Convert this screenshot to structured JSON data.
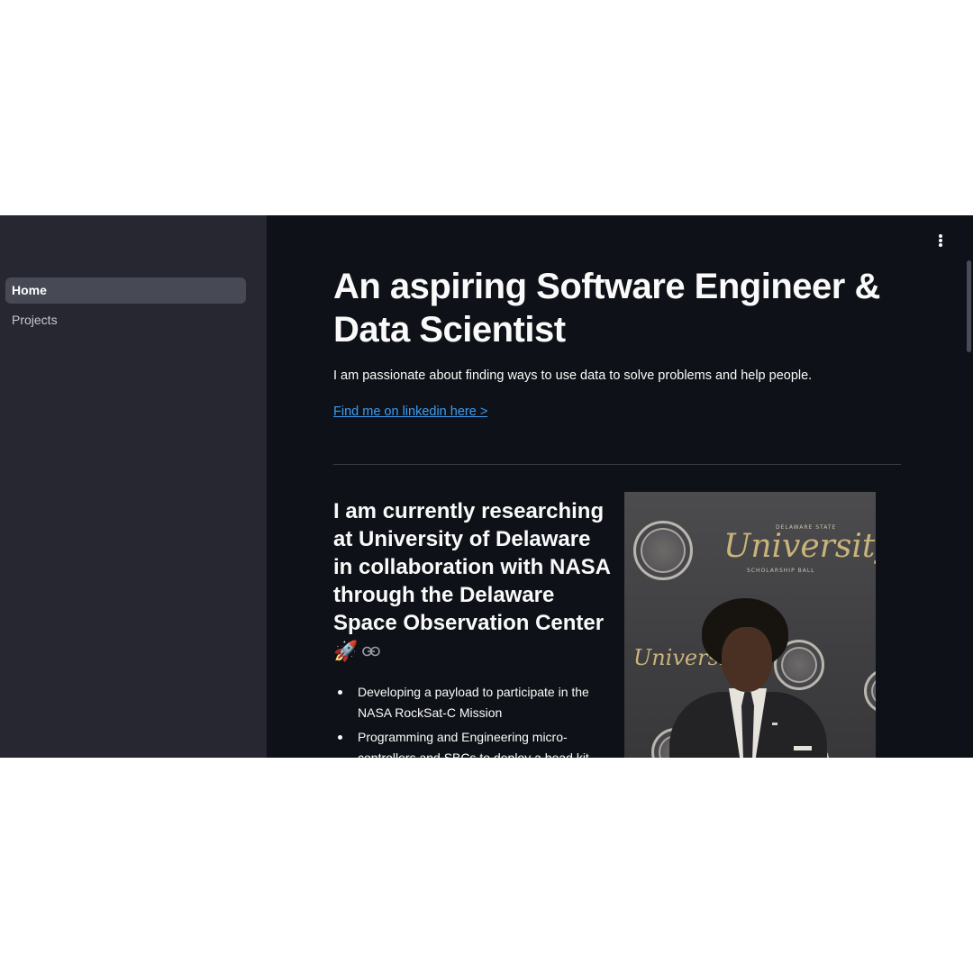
{
  "sidebar": {
    "items": [
      {
        "label": "Home",
        "active": true
      },
      {
        "label": "Projects",
        "active": false
      }
    ]
  },
  "header": {
    "menu_icon": "kebab-menu-icon"
  },
  "main": {
    "title": "An aspiring Software Engineer & Data Scientist",
    "subtitle": "I am passionate about finding ways to use data to solve problems and help people.",
    "linkedin_link": "Find me on linkedin here >",
    "research": {
      "title": "I am currently researching at University of Delaware in collaboration with NASA through the Delaware Space Observation Center",
      "emoji": "🚀",
      "anchor_icon": "link-icon",
      "bullets": [
        "Developing a payload to participate in the NASA RockSat-C Mission",
        "Programming and Engineering micro-controllers and SBCs to deploy a bead kit"
      ]
    },
    "photo": {
      "logo_text": "University",
      "logo_top": "DELAWARE STATE",
      "logo_sub": "SCHOLARSHIP BALL"
    }
  },
  "colors": {
    "sidebar_bg": "#262730",
    "main_bg": "#0e1117",
    "active_nav_bg": "#474954",
    "link": "#3d9df3",
    "text": "#fafafa"
  }
}
